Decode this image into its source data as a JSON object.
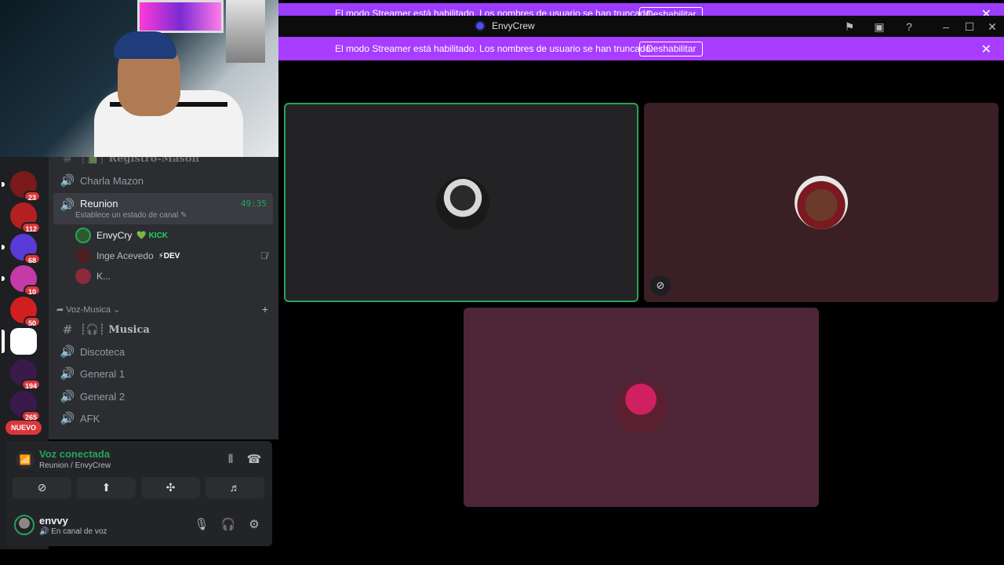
{
  "window": {
    "title": "EnvyCrew"
  },
  "top_banner": {
    "text": "El modo Streamer está habilitado. Los nombres de usuario se han truncado.",
    "button": "Deshabilitar"
  },
  "streamer_bar": {
    "text": "El modo Streamer está habilitado. Los nombres de usuario se han truncado.",
    "button": "Deshabilitar",
    "close_glyph": "✕"
  },
  "titlebar_icons": [
    "flag-icon",
    "inbox-icon",
    "help-icon",
    "minimize-icon",
    "maximize-icon",
    "close-icon"
  ],
  "servers": [
    {
      "badge": "23",
      "color": "#7a1a1a"
    },
    {
      "badge": "112",
      "color": "#b32020"
    },
    {
      "badge": "68",
      "color": "#5a3ad6"
    },
    {
      "badge": "10",
      "color": "#c43aa8"
    },
    {
      "badge": "50",
      "color": "#d11f1f"
    },
    {
      "badge": "",
      "color": "#ffffff"
    },
    {
      "badge": "194",
      "color": "#3a1a4a"
    },
    {
      "badge": "265",
      "color": "#3a1a4a"
    }
  ],
  "nuevo_label": "NUEVO",
  "channels": {
    "registro": "┊📗┊ Registro-Mason",
    "charla": "Charla Mazon",
    "active": {
      "name": "Reunion",
      "time": "49:35",
      "status": "Establece un estado de canal"
    },
    "members": [
      {
        "name": "EnvyCry",
        "tag": "💚 KICK",
        "color": "#2d5a2d"
      },
      {
        "name": "Inge Acevedo",
        "tag": "⚡DEV",
        "color": "#4a2020"
      },
      {
        "name": "K...",
        "tag": "",
        "color": "#8a2a3a"
      }
    ],
    "category": "➦ Voz-Musica ⌄",
    "musica": "┊🎧┊ Musica",
    "discoteca": "Discoteca",
    "general1": "General 1",
    "general2": "General 2",
    "afk": "AFK"
  },
  "voice_panel": {
    "title": "Voz conectada",
    "subtitle": "Reunion / EnvyCrew"
  },
  "user_panel": {
    "name": "envvy",
    "status": "En canal de voz"
  },
  "stage": {
    "tiles": [
      {
        "bg": "#232325",
        "speaking": true,
        "muted": false
      },
      {
        "bg": "#3a1f24",
        "speaking": false,
        "muted": true
      },
      {
        "bg": "#4e2437",
        "speaking": false,
        "muted": false
      }
    ]
  }
}
